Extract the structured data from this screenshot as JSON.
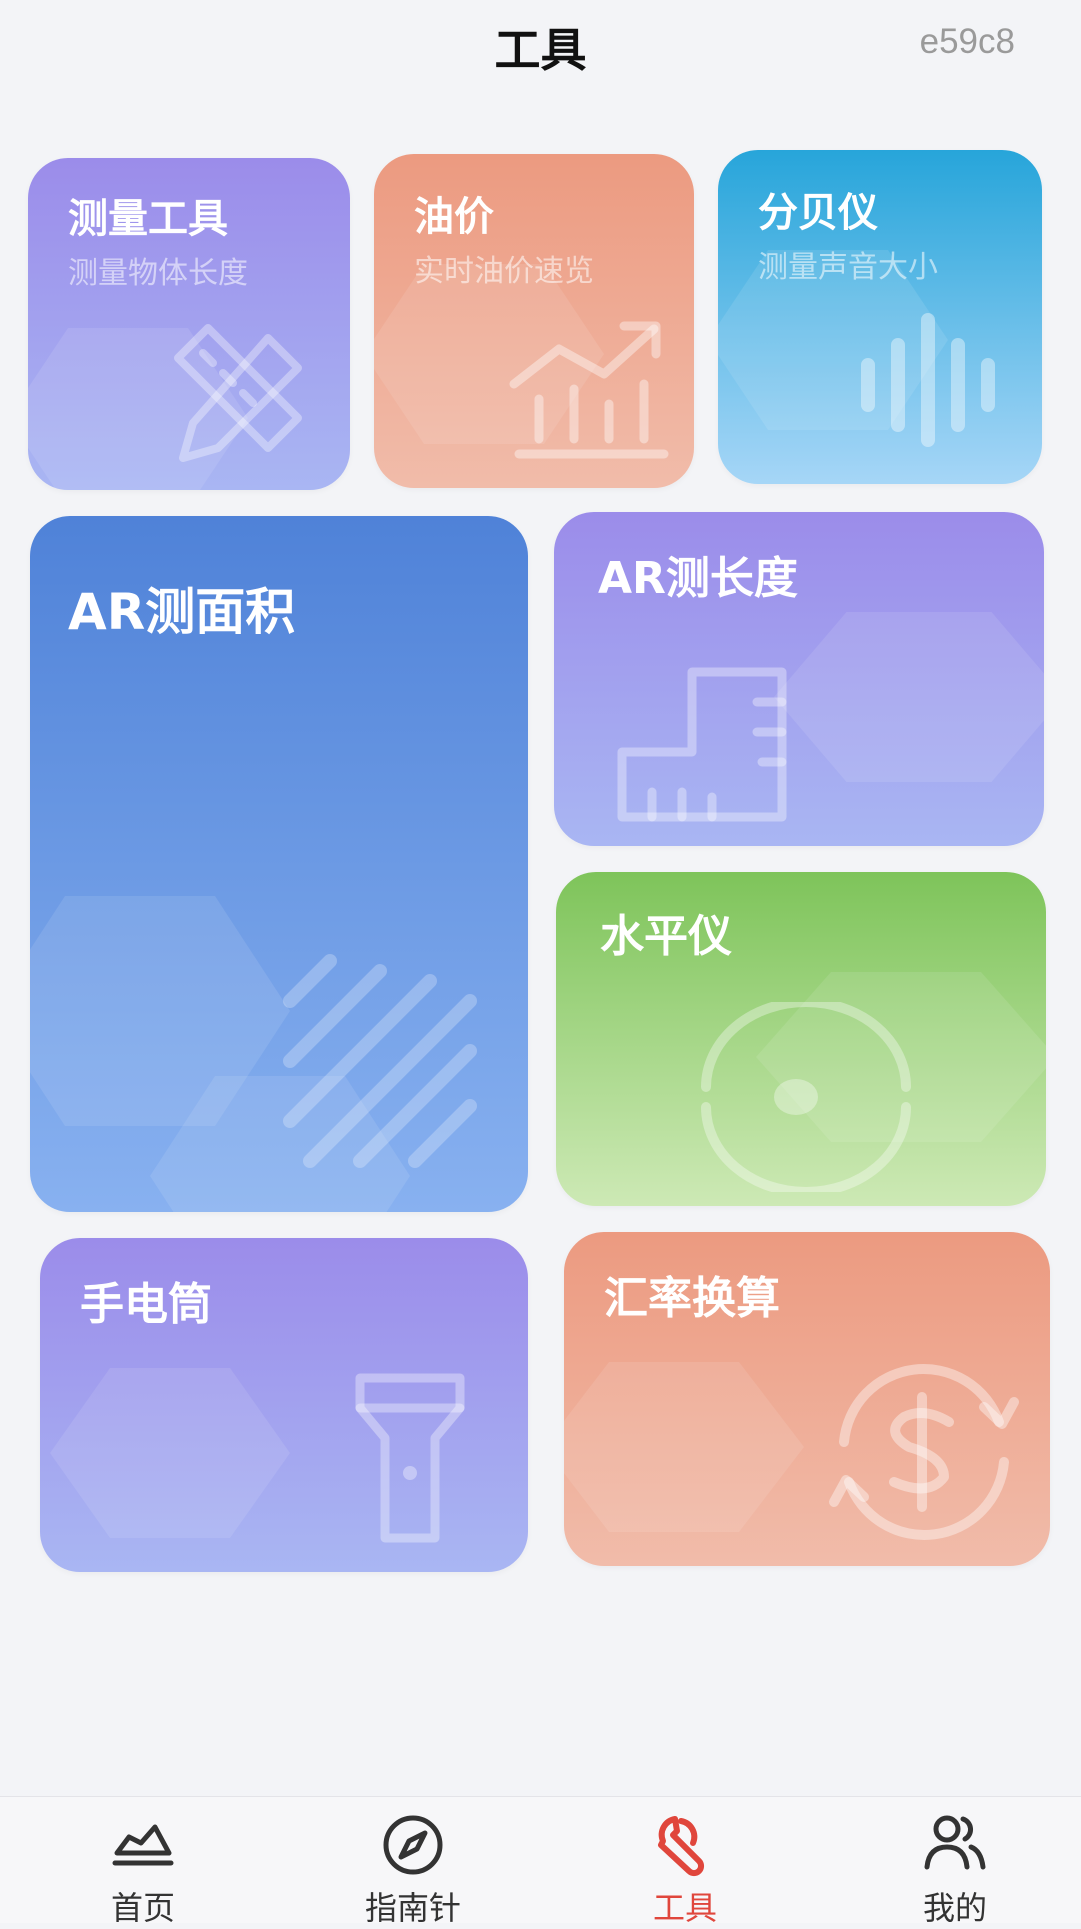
{
  "header": {
    "title": "工具",
    "code": "e59c8"
  },
  "cards": {
    "measure": {
      "title": "测量工具",
      "subtitle": "测量物体长度",
      "icon": "ruler-pencil-icon"
    },
    "oil": {
      "title": "油价",
      "subtitle": "实时油价速览",
      "icon": "trend-chart-icon"
    },
    "decibel": {
      "title": "分贝仪",
      "subtitle": "测量声音大小",
      "icon": "sound-wave-icon"
    },
    "ar_area": {
      "title": "AR测面积",
      "icon": "diagonal-lines-icon"
    },
    "ar_length": {
      "title": "AR测长度",
      "icon": "l-ruler-icon"
    },
    "level": {
      "title": "水平仪",
      "icon": "level-bubble-icon"
    },
    "flashlight": {
      "title": "手电筒",
      "icon": "flashlight-icon"
    },
    "exchange": {
      "title": "汇率换算",
      "icon": "currency-exchange-icon"
    }
  },
  "tabbar": {
    "items": [
      {
        "label": "首页",
        "icon": "home-icon",
        "active": false
      },
      {
        "label": "指南针",
        "icon": "compass-icon",
        "active": false
      },
      {
        "label": "工具",
        "icon": "wrench-icon",
        "active": true
      },
      {
        "label": "我的",
        "icon": "users-icon",
        "active": false
      }
    ],
    "active_color": "#e0463c"
  }
}
